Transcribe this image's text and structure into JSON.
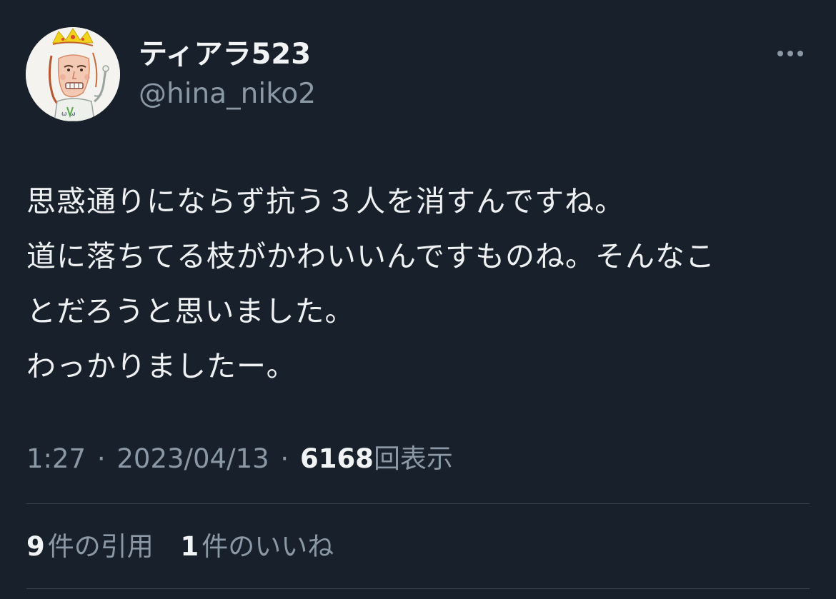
{
  "user": {
    "display_name": "ティアラ523",
    "handle": "@hina_niko2",
    "avatar_icon": "avatar-drawing-crowned-face"
  },
  "more_icon": "more-horizontal-icon",
  "tweet": {
    "lines": [
      "思惑通りにならず抗う３人を消すんですね。",
      "道に落ちてる枝がかわいいんですものね。そんなこ",
      "とだろうと思いました。",
      "わっかりましたー。"
    ]
  },
  "meta": {
    "time": "1:27",
    "separator": "·",
    "date": "2023/04/13",
    "views_count": "6168",
    "views_label": "回表示"
  },
  "stats": {
    "quotes_count": "9",
    "quotes_label": "件の引用",
    "likes_count": "1",
    "likes_label": "件のいいね"
  },
  "colors": {
    "background": "#17202b",
    "text_primary": "#f2f3f4",
    "text_secondary": "#8b98a5",
    "divider": "#38444d"
  }
}
